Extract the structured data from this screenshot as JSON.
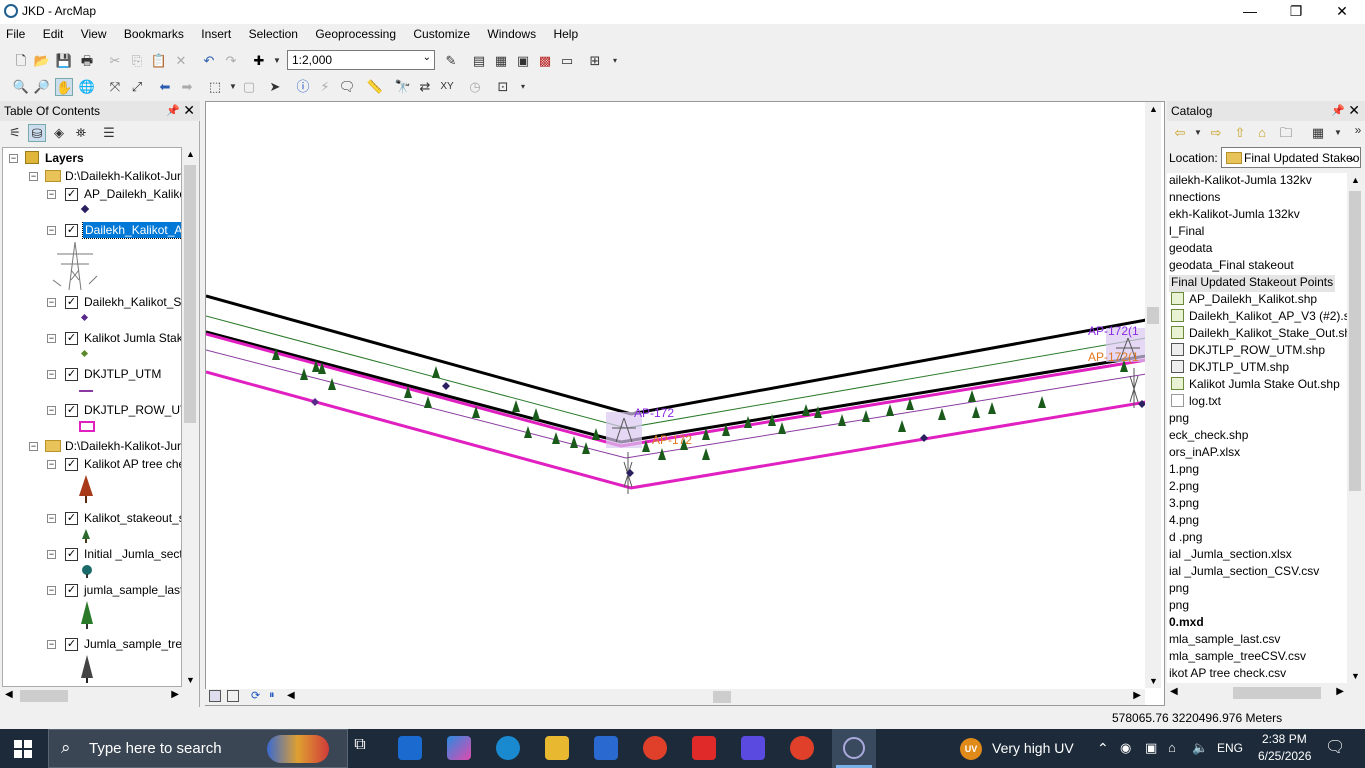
{
  "window": {
    "title": "JKD - ArcMap",
    "minimize": "—",
    "maximize": "❐",
    "close": "✕"
  },
  "menu": [
    "File",
    "Edit",
    "View",
    "Bookmarks",
    "Insert",
    "Selection",
    "Geoprocessing",
    "Customize",
    "Windows",
    "Help"
  ],
  "toolbar": {
    "scale": "1:2,000"
  },
  "toc": {
    "title": "Table Of Contents",
    "root": "Layers",
    "group1": "D:\\Dailekh-Kalikot-Jur",
    "layers1": [
      "AP_Dailekh_Kalikot",
      "Dailekh_Kalikot_AP",
      "Dailekh_Kalikot_Sta",
      "Kalikot Jumla Stake",
      "DKJTLP_UTM",
      "DKJTLP_ROW_UTM"
    ],
    "group2": "D:\\Dailekh-Kalikot-Jur",
    "layers2": [
      "Kalikot AP tree che",
      "Kalikot_stakeout_s",
      "Initial _Jumla_secti",
      "jumla_sample_last",
      "Jumla_sample_tree"
    ]
  },
  "map": {
    "labels": [
      {
        "text": "AP-172",
        "color": "#8a2be2"
      },
      {
        "text": "AP-172",
        "color": "#e07820"
      },
      {
        "text": "AP-172(1",
        "color": "#8a2be2"
      },
      {
        "text": "AP-172(1",
        "color": "#e07820"
      }
    ]
  },
  "catalog": {
    "title": "Catalog",
    "location_label": "Location:",
    "location_value": "Final Updated Stakeo",
    "items": [
      "ailekh-Kalikot-Jumla 132kv",
      "nnections",
      "ekh-Kalikot-Jumla 132kv",
      "l_Final",
      "geodata",
      "geodata_Final stakeout",
      "Final Updated Stakeout Points",
      "AP_Dailekh_Kalikot.shp",
      "Dailekh_Kalikot_AP_V3 (#2).sh",
      "Dailekh_Kalikot_Stake_Out.sh",
      "DKJTLP_ROW_UTM.shp",
      "DKJTLP_UTM.shp",
      "Kalikot Jumla Stake Out.shp",
      "log.txt",
      "png",
      "eck_check.shp",
      "ors_inAP.xlsx",
      "1.png",
      "2.png",
      "3.png",
      "4.png",
      "d .png",
      "ial _Jumla_section.xlsx",
      "ial _Jumla_section_CSV.csv",
      "png",
      "png",
      "0.mxd",
      "mla_sample_last.csv",
      "mla_sample_treeCSV.csv",
      "ikot AP tree check.csv"
    ]
  },
  "status": {
    "coords": "578065.76  3220496.976 Meters"
  },
  "taskbar": {
    "search_placeholder": "Type here to search",
    "weather": "Very high UV",
    "weather_badge": "UV",
    "lang": "ENG",
    "time": "2:38 PM",
    "date": "6/25/2026"
  }
}
